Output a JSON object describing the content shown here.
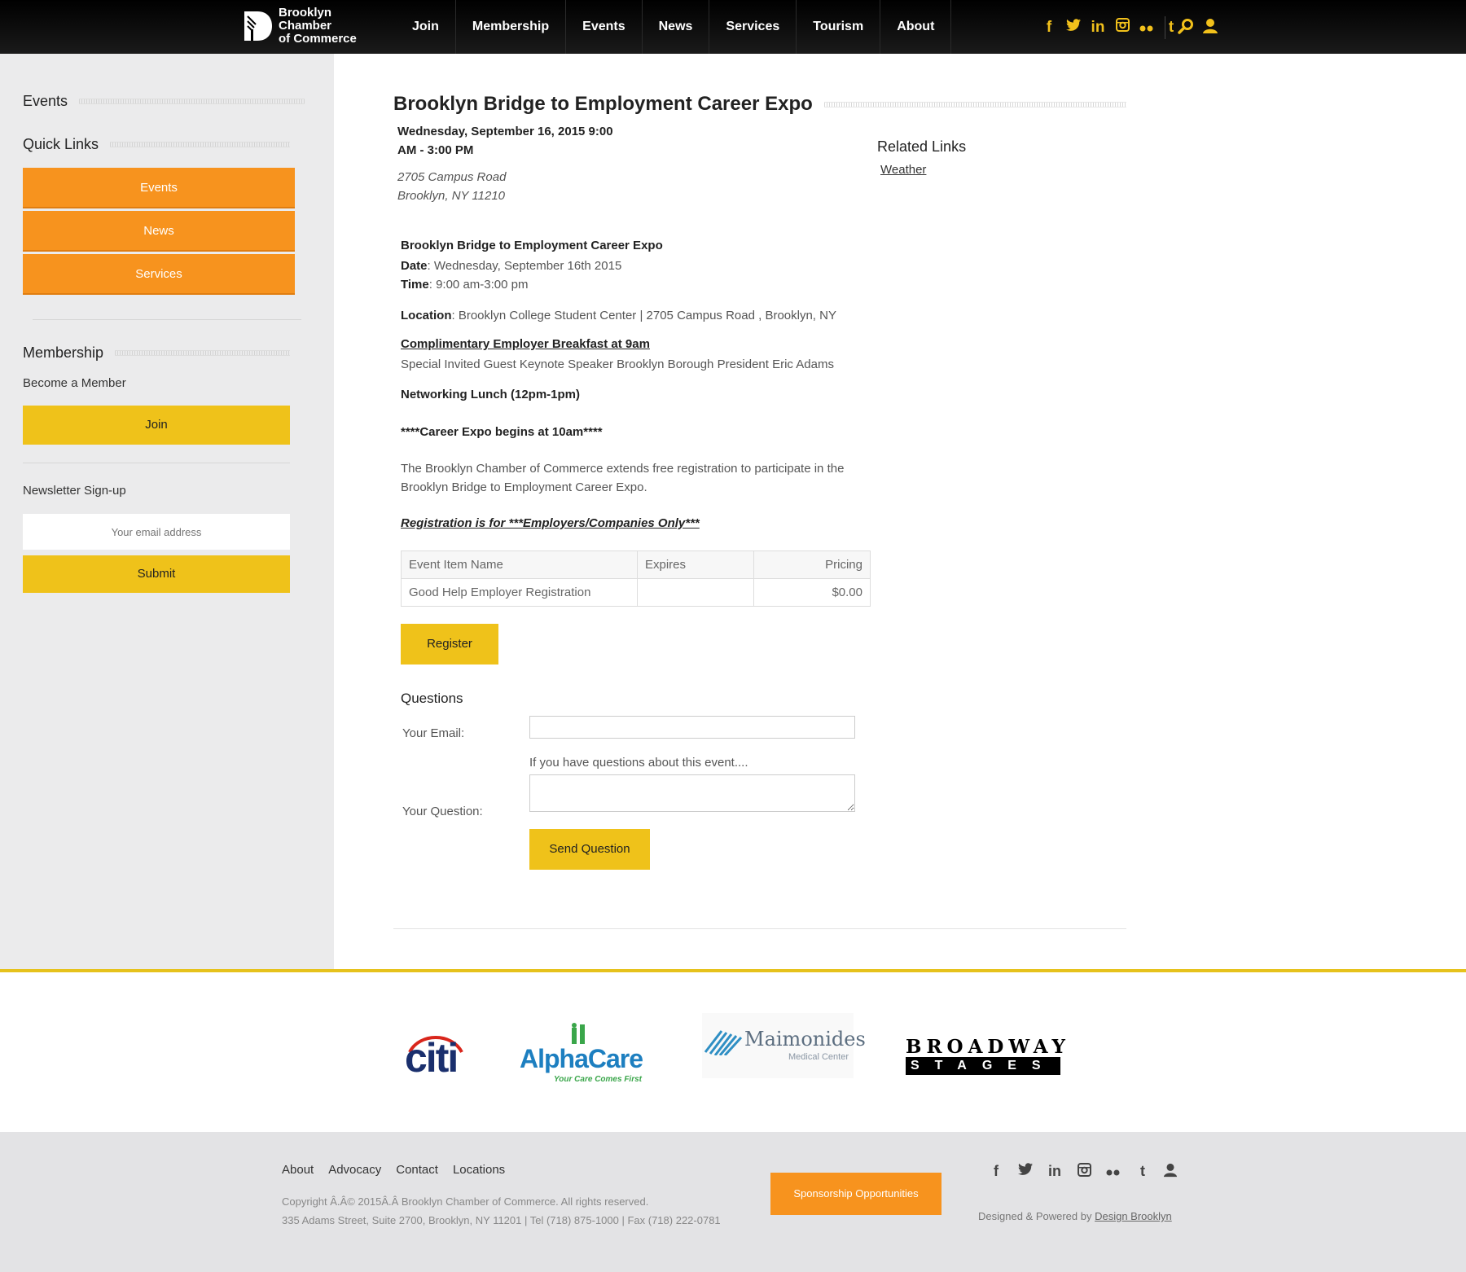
{
  "brand": {
    "name_line1": "Brooklyn Chamber",
    "name_line2": "of Commerce",
    "accent": "#f7931e",
    "yellow": "#efc21a"
  },
  "nav": [
    "Join",
    "Membership",
    "Events",
    "News",
    "Services",
    "Tourism",
    "About"
  ],
  "social_icons": [
    "facebook-icon",
    "twitter-icon",
    "linkedin-icon",
    "instagram-icon",
    "flickr-icon",
    "tumblr-icon"
  ],
  "sidebar": {
    "events_title": "Events",
    "quick_links_title": "Quick Links",
    "quick_links": [
      "Events",
      "News",
      "Services"
    ],
    "membership_title": "Membership",
    "become_member": "Become a Member",
    "join_label": "Join",
    "newsletter_title": "Newsletter Sign-up",
    "email_placeholder": "Your email address",
    "submit_label": "Submit"
  },
  "event": {
    "title": "Brooklyn Bridge to Employment Career Expo",
    "date_line1": "Wednesday, September 16, 2015 9:00",
    "date_line2": "AM - 3:00 PM",
    "address_line1": "2705 Campus Road",
    "address_line2": "Brooklyn, NY 11210",
    "body_title": "Brooklyn Bridge to Employment Career Expo",
    "date_label": "Date",
    "date_value": ": Wednesday, September 16th 2015",
    "time_label": "Time",
    "time_value": ":  9:00 am-3:00 pm",
    "location_label": "Location",
    "location_value": ": Brooklyn College Student Center | 2705 Campus Road , Brooklyn, NY",
    "breakfast": "Complimentary Employer Breakfast at 9am",
    "keynote": "Special Invited Guest Keynote Speaker Brooklyn Borough President Eric Adams",
    "lunch": "Networking Lunch (12pm-1pm)",
    "expo_begins": "****Career Expo begins at 10am****",
    "description": "The Brooklyn Chamber of Commerce extends free registration to participate in the Brooklyn Bridge to Employment Career Expo.",
    "registration_note": "Registration is for ***Employers/Companies Only***"
  },
  "related": {
    "title": "Related Links",
    "links": [
      "Weather"
    ]
  },
  "registration_table": {
    "headers": [
      "Event Item Name",
      "Expires",
      "Pricing"
    ],
    "rows": [
      [
        "Good Help Employer Registration",
        "",
        "$0.00"
      ]
    ]
  },
  "register_label": "Register",
  "questions": {
    "title": "Questions",
    "email_label": "Your Email:",
    "question_hint": "If you have questions about this event....",
    "question_label": "Your Question:",
    "send_label": "Send Question"
  },
  "sponsors": {
    "citi": "citi",
    "alphacare": "AlphaCare",
    "alphacare_tag": "Your Care Comes First",
    "maimonides": "Maimonides",
    "maimonides_sub": "Medical Center",
    "broadway_top": "BROADWAY",
    "broadway_bottom": "STAGES"
  },
  "footer": {
    "links": [
      "About",
      "Advocacy",
      "Contact",
      "Locations"
    ],
    "copyright": "Copyright Â.Â© 2015Â.Â Brooklyn Chamber of Commerce. All rights reserved.",
    "address": "335 Adams Street, Suite 2700, Brooklyn, NY 11201 | Tel (718) 875-1000 | Fax (718) 222-0781",
    "sponsorship_label": "Sponsorship Opportunities",
    "designed_prefix": "Designed & Powered by ",
    "designed_link": "Design Brooklyn"
  }
}
